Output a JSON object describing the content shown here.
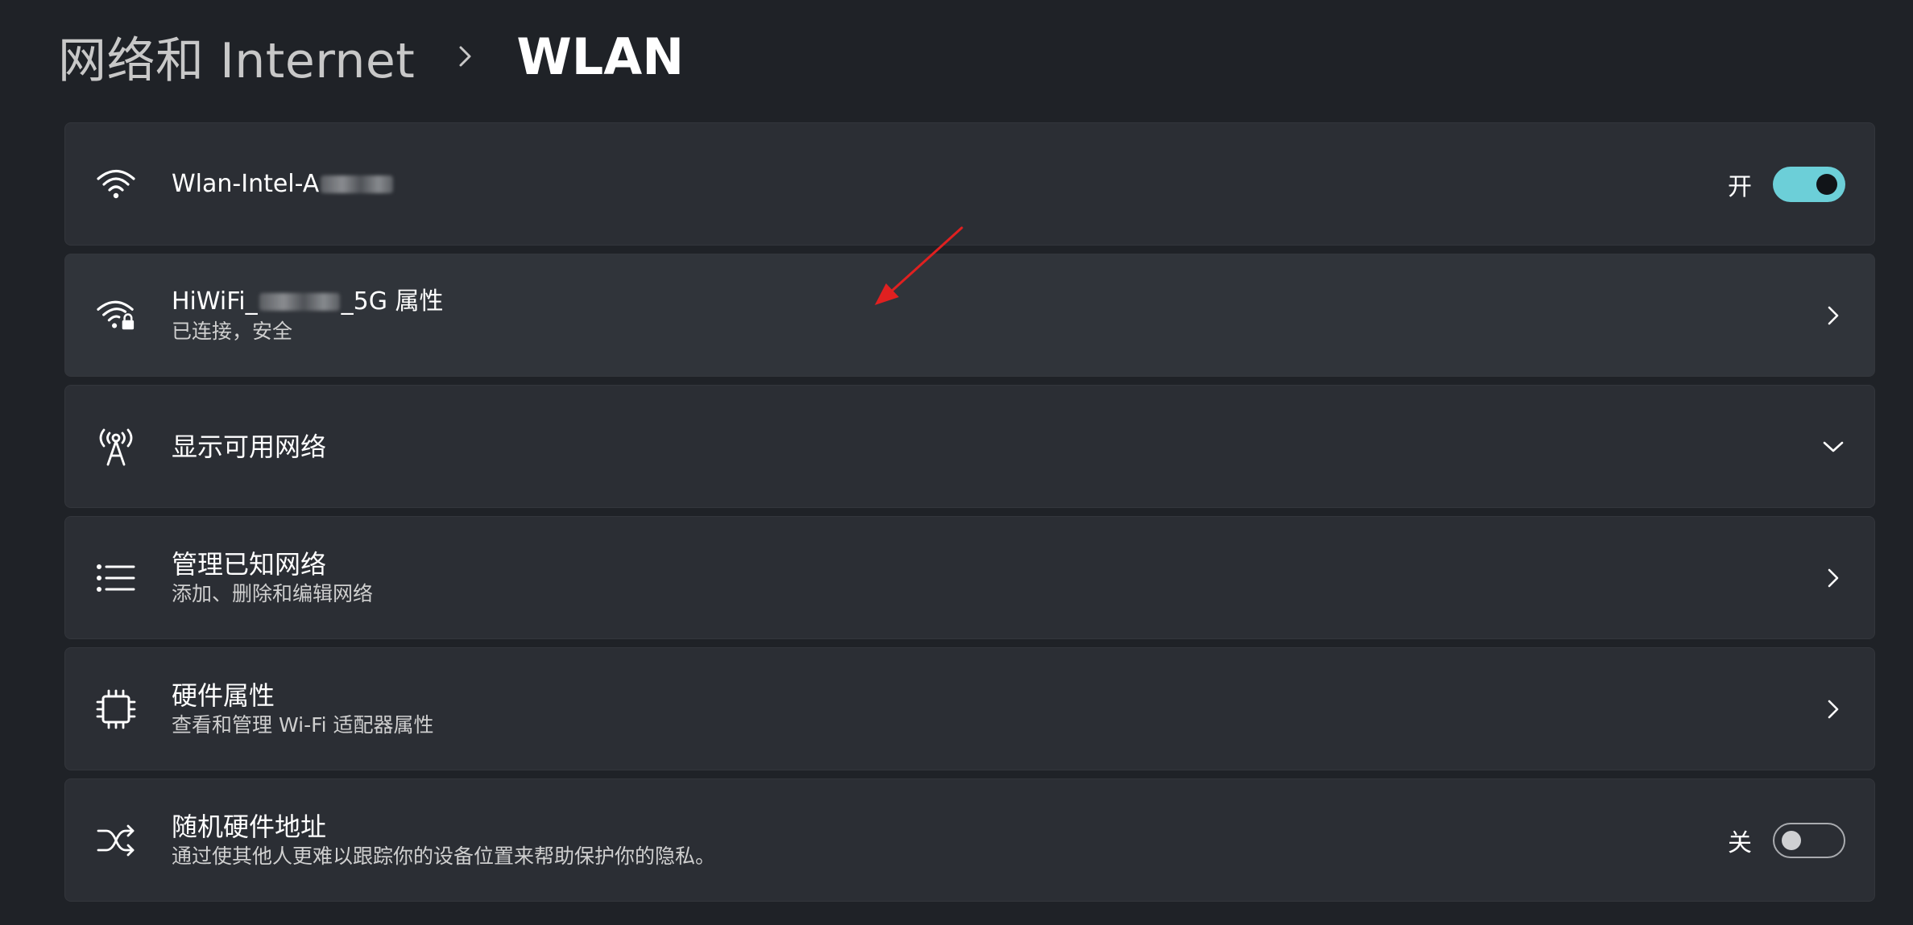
{
  "breadcrumb": {
    "parent": "网络和 Internet",
    "current": "WLAN"
  },
  "adapter": {
    "name_visible": "Wlan-Intel-A",
    "state": "开",
    "enabled": true
  },
  "connection": {
    "name_prefix": "HiWiFi_",
    "name_suffix": "_5G 属性",
    "status": "已连接，安全"
  },
  "available_networks": {
    "title": "显示可用网络"
  },
  "known_networks": {
    "title": "管理已知网络",
    "subtitle": "添加、删除和编辑网络"
  },
  "hardware": {
    "title": "硬件属性",
    "subtitle": "查看和管理 Wi-Fi 适配器属性"
  },
  "random_mac": {
    "title": "随机硬件地址",
    "subtitle": "通过使其他人更难以跟踪你的设备位置来帮助保护你的隐私。",
    "state": "关",
    "enabled": false
  },
  "colors": {
    "background": "#1f2227",
    "card": "#2b2e34",
    "accent": "#6ccfd8",
    "annotation_arrow": "#e02020"
  },
  "icons": {
    "wifi": "wifi-icon",
    "wifi_locked": "wifi-lock-icon",
    "antenna": "antenna-icon",
    "list": "list-icon",
    "chip": "chip-icon",
    "shuffle": "shuffle-icon",
    "chevron_right": "chevron-right-icon",
    "chevron_down": "chevron-down-icon"
  }
}
